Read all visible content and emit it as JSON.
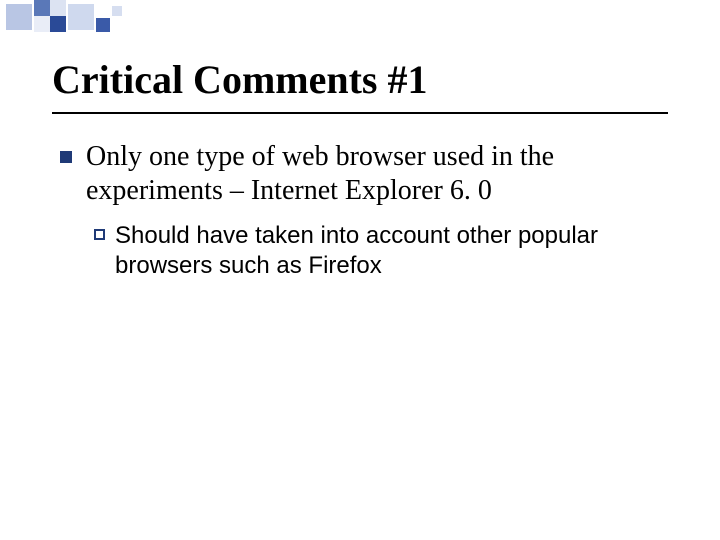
{
  "title": "Critical Comments #1",
  "bullets": [
    {
      "text": "Only one type of web browser used in the experiments – Internet Explorer 6. 0",
      "children": [
        {
          "text": "Should have taken into account other popular browsers such as Firefox"
        }
      ]
    }
  ],
  "theme": {
    "accent": "#1f3a77",
    "background": "#ffffff",
    "title_font": "Times New Roman",
    "body_font_l1": "Times New Roman",
    "body_font_l2": "Arial"
  }
}
